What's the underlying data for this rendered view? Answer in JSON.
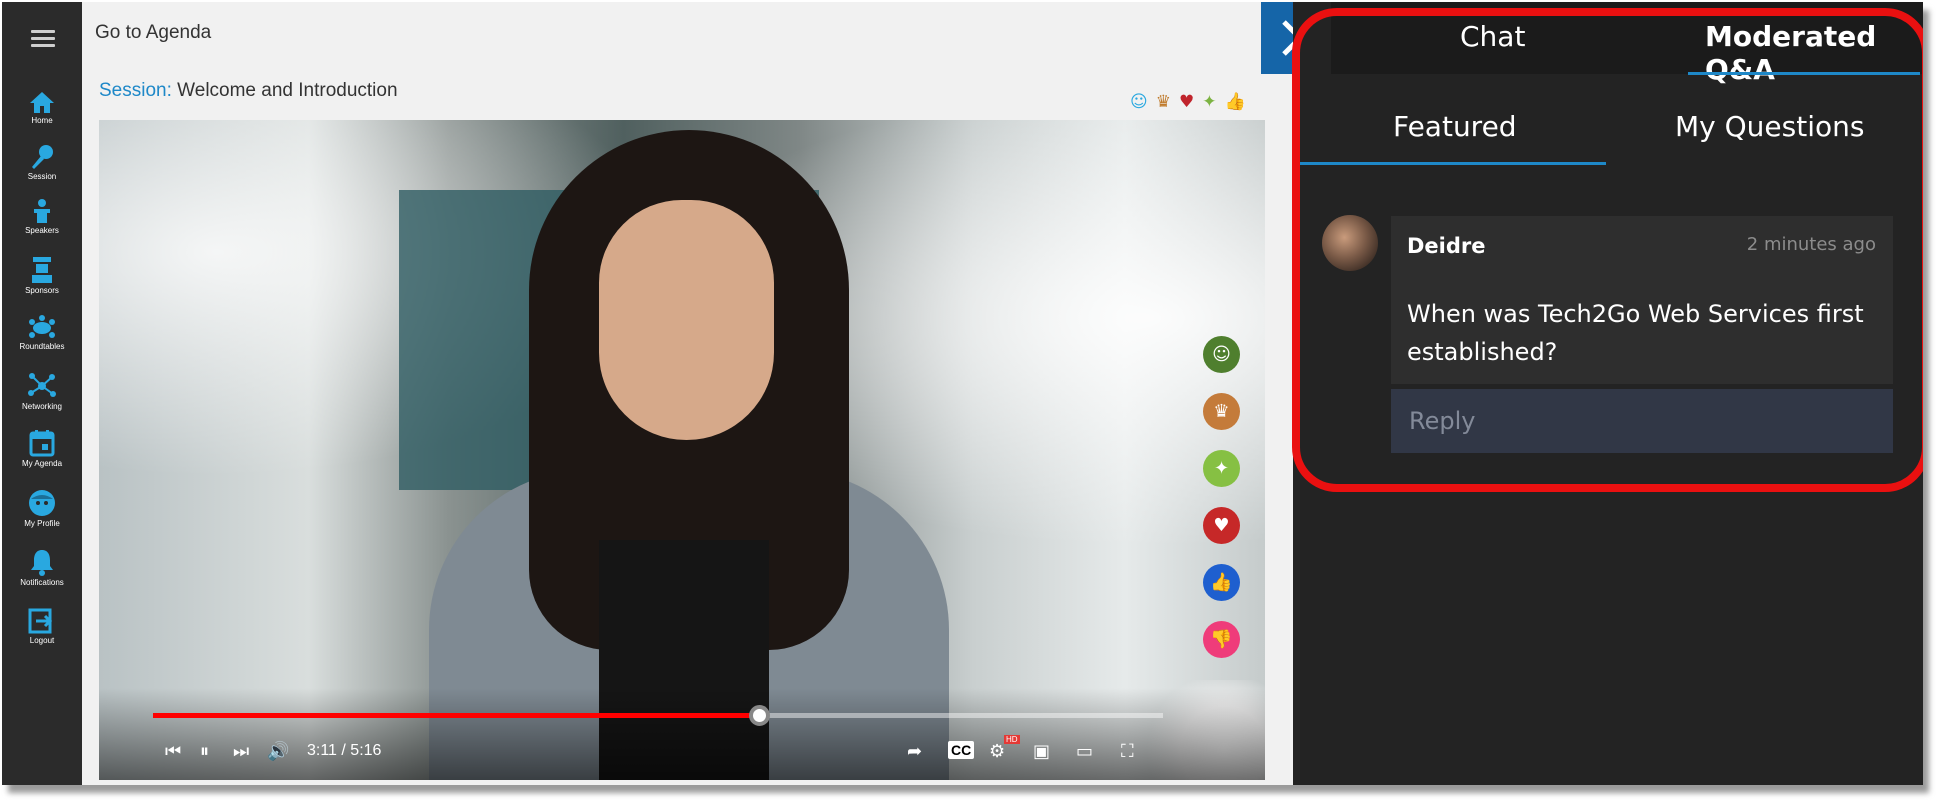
{
  "nav": {
    "items": [
      {
        "label": "Home",
        "icon": "home-icon"
      },
      {
        "label": "Session",
        "icon": "microphone-icon"
      },
      {
        "label": "Speakers",
        "icon": "speaker-podium-icon"
      },
      {
        "label": "Sponsors",
        "icon": "sponsor-booth-icon"
      },
      {
        "label": "Roundtables",
        "icon": "roundtable-icon"
      },
      {
        "label": "Networking",
        "icon": "network-icon"
      },
      {
        "label": "My Agenda",
        "icon": "calendar-icon"
      },
      {
        "label": "My Profile",
        "icon": "profile-icon"
      },
      {
        "label": "Notifications",
        "icon": "bell-icon"
      },
      {
        "label": "Logout",
        "icon": "logout-icon"
      }
    ]
  },
  "header": {
    "goto_agenda": "Go to Agenda",
    "session_label": "Session:",
    "session_title": "Welcome and Introduction"
  },
  "video": {
    "current_time": "3:11",
    "duration": "5:16",
    "time_display": "3:11 / 5:16",
    "progress": 0.6,
    "cc_label": "CC",
    "hd_badge": "HD"
  },
  "reactions": [
    "smile",
    "clap",
    "heart",
    "celebrate",
    "thumbs-up",
    "thumbs-down"
  ],
  "panel": {
    "tabs": {
      "chat": "Chat",
      "qa": "Moderated Q&A"
    },
    "subtabs": {
      "featured": "Featured",
      "my_questions": "My Questions"
    },
    "question": {
      "author": "Deidre",
      "time": "2 minutes ago",
      "text": "When was Tech2Go Web Services first established?"
    },
    "reply_placeholder": "Reply"
  },
  "colors": {
    "accent": "#1e88c8",
    "highlight_ring": "#ea1010",
    "progress_red": "#ff0000"
  }
}
